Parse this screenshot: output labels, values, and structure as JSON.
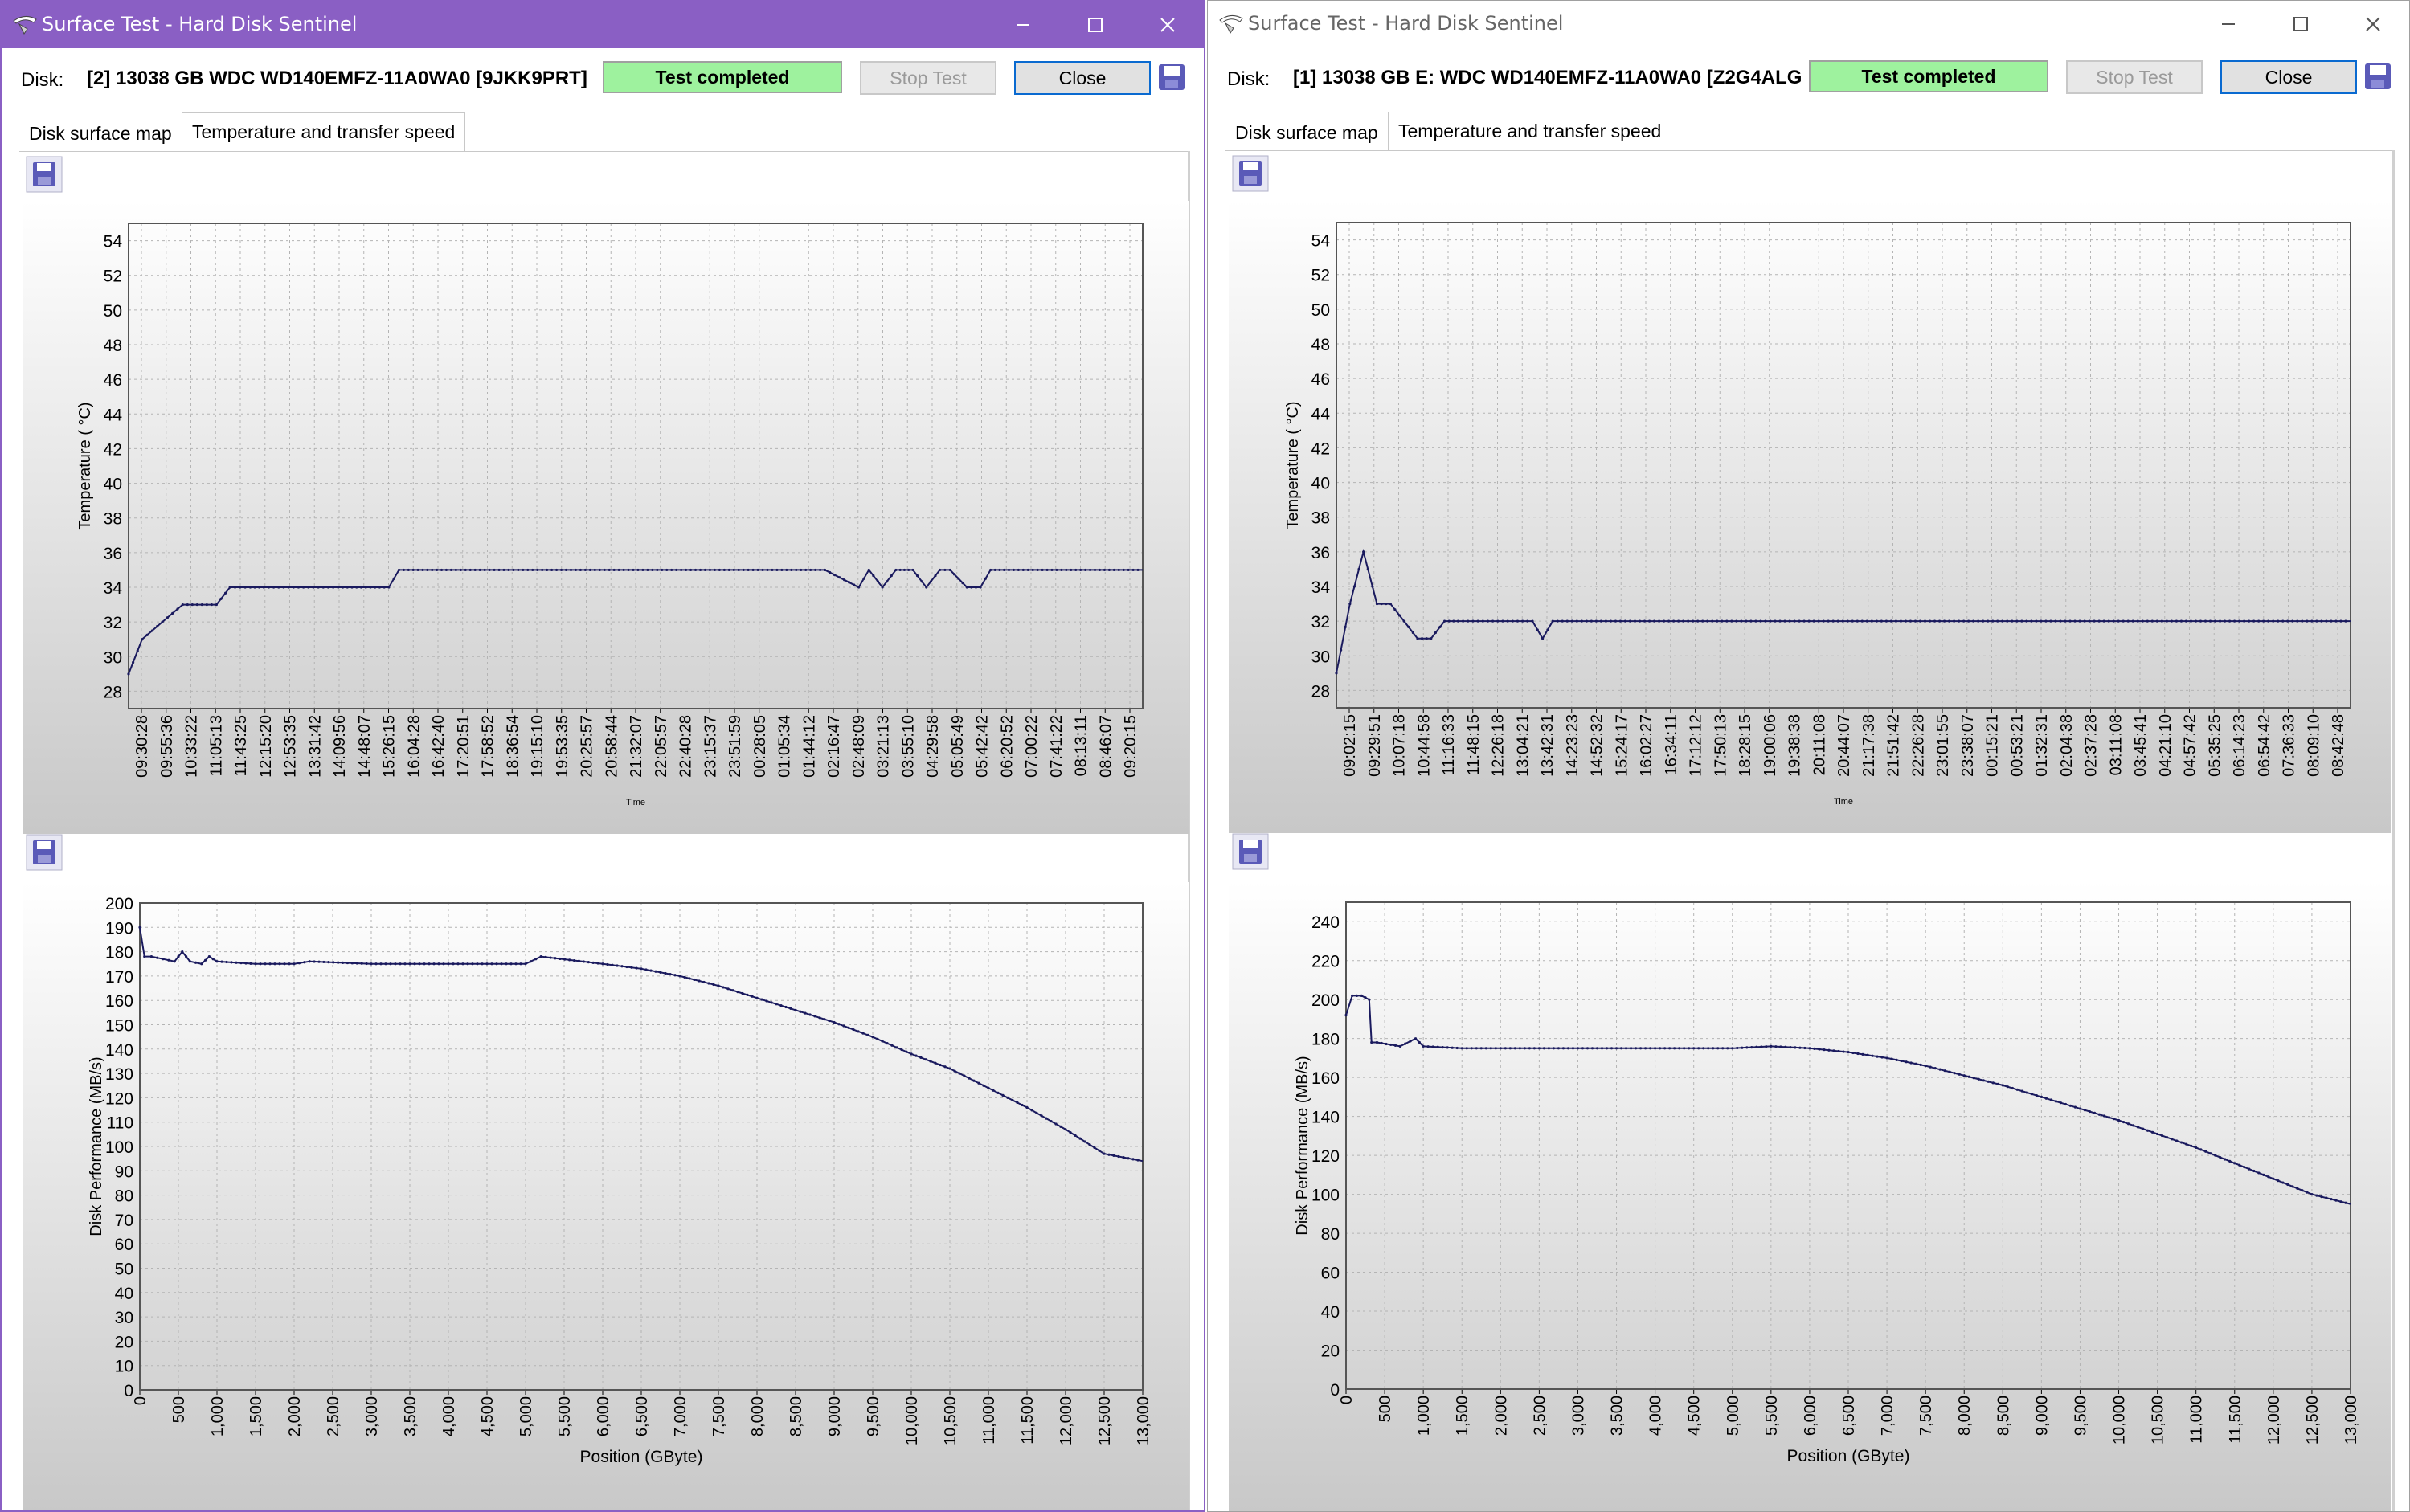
{
  "windows": [
    {
      "id": "left",
      "title": "Surface Test - Hard Disk Sentinel",
      "disk_label": "Disk:",
      "disk_name": "[2] 13038 GB  WDC WD140EMFZ-11A0WA0 [9JKK9PRT]",
      "status": "Test completed",
      "stop_button": "Stop Test",
      "close_button": "Close",
      "tabs": [
        "Disk surface map",
        "Temperature and transfer speed"
      ],
      "active_tab": "Temperature and transfer speed"
    },
    {
      "id": "right",
      "title": "Surface Test - Hard Disk Sentinel",
      "disk_label": "Disk:",
      "disk_name": "[1] 13038 GB E: WDC WD140EMFZ-11A0WA0 [Z2G4ALG",
      "status": "Test completed",
      "stop_button": "Stop Test",
      "close_button": "Close",
      "tabs": [
        "Disk surface map",
        "Temperature and transfer speed"
      ],
      "active_tab": "Temperature and transfer speed"
    }
  ],
  "colors": {
    "title_active": "#8a5fc4",
    "status_green": "#9ef29e",
    "line": "#1a1a5e",
    "plot_bg_top": "#ffffff",
    "plot_bg_bottom": "#c8c8c8"
  },
  "chart_data": [
    {
      "id": "left-temp",
      "type": "line",
      "ylabel": "Temperature ( °C)",
      "xlabel": "Time",
      "ylim": [
        27,
        55
      ],
      "yticks": [
        28,
        30,
        32,
        34,
        36,
        38,
        40,
        42,
        44,
        46,
        48,
        50,
        52,
        54
      ],
      "grid": true,
      "x_tick_labels": [
        "09:30:28",
        "09:55:36",
        "10:33:22",
        "11:05:13",
        "11:43:25",
        "12:15:20",
        "12:53:35",
        "13:31:42",
        "14:09:56",
        "14:48:07",
        "15:26:15",
        "16:04:28",
        "16:42:40",
        "17:20:51",
        "17:58:52",
        "18:36:54",
        "19:15:10",
        "19:53:35",
        "20:25:57",
        "20:58:44",
        "21:32:07",
        "22:05:57",
        "22:40:28",
        "23:15:37",
        "23:51:59",
        "00:28:05",
        "01:05:34",
        "01:44:12",
        "02:16:47",
        "02:48:09",
        "03:21:13",
        "03:55:10",
        "04:29:58",
        "05:05:49",
        "05:42:42",
        "06:20:52",
        "07:00:22",
        "07:41:22",
        "08:13:11",
        "08:46:07",
        "09:20:15"
      ],
      "series": [
        {
          "x": [
            0,
            0.4,
            1.0,
            1.6,
            2.6,
            3.0,
            3.6,
            4.0,
            6.2,
            7.7,
            8.0,
            9.4,
            20.6,
            21.6,
            21.9,
            22.3,
            22.7,
            23.2,
            23.6,
            24.0,
            24.3,
            24.8,
            25.2,
            25.5,
            25.9,
            30.0
          ],
          "values": [
            29,
            31,
            32,
            33,
            33,
            34,
            34,
            34,
            34,
            34,
            35,
            35,
            35,
            34,
            35,
            34,
            35,
            35,
            34,
            35,
            35,
            34,
            34,
            35,
            35,
            35
          ]
        }
      ],
      "x_range": [
        0,
        30
      ]
    },
    {
      "id": "left-perf",
      "type": "line",
      "ylabel": "Disk Performance (MB/s)",
      "xlabel": "Position (GByte)",
      "ylim": [
        0,
        200
      ],
      "yticks": [
        0,
        10,
        20,
        30,
        40,
        50,
        60,
        70,
        80,
        90,
        100,
        110,
        120,
        130,
        140,
        150,
        160,
        170,
        180,
        190,
        200
      ],
      "xlim": [
        0,
        13000
      ],
      "xticks": [
        0,
        500,
        1000,
        1500,
        2000,
        2500,
        3000,
        3500,
        4000,
        4500,
        5000,
        5500,
        6000,
        6500,
        7000,
        7500,
        8000,
        8500,
        9000,
        9500,
        10000,
        10500,
        11000,
        11500,
        12000,
        12500,
        13000
      ],
      "x_tick_labels": [
        "0",
        "500",
        "1,000",
        "1,500",
        "2,000",
        "2,500",
        "3,000",
        "3,500",
        "4,000",
        "4,500",
        "5,000",
        "5,500",
        "6,000",
        "6,500",
        "7,000",
        "7,500",
        "8,000",
        "8,500",
        "9,000",
        "9,500",
        "10,000",
        "10,500",
        "11,000",
        "11,500",
        "12,000",
        "12,500",
        "13,000"
      ],
      "grid": true,
      "series": [
        {
          "x": [
            0,
            60,
            150,
            300,
            450,
            550,
            650,
            800,
            900,
            1000,
            1500,
            2000,
            2200,
            3000,
            4000,
            5000,
            5200,
            6000,
            6500,
            7000,
            7500,
            8000,
            8500,
            9000,
            9500,
            10000,
            10500,
            11000,
            11500,
            12000,
            12500,
            13000
          ],
          "values": [
            190,
            178,
            178,
            177,
            176,
            180,
            176,
            175,
            178,
            176,
            175,
            175,
            176,
            175,
            175,
            175,
            178,
            175,
            173,
            170,
            166,
            161,
            156,
            151,
            145,
            138,
            132,
            124,
            116,
            107,
            97,
            94
          ]
        }
      ]
    },
    {
      "id": "right-temp",
      "type": "line",
      "ylabel": "Temperature ( °C)",
      "xlabel": "Time",
      "ylim": [
        27,
        55
      ],
      "yticks": [
        28,
        30,
        32,
        34,
        36,
        38,
        40,
        42,
        44,
        46,
        48,
        50,
        52,
        54
      ],
      "grid": true,
      "x_tick_labels": [
        "09:02:15",
        "09:29:51",
        "10:07:18",
        "10:44:58",
        "11:16:33",
        "11:48:15",
        "12:26:18",
        "13:04:21",
        "13:42:31",
        "14:23:23",
        "14:52:32",
        "15:24:17",
        "16:02:27",
        "16:34:11",
        "17:12:12",
        "17:50:13",
        "18:28:15",
        "19:00:06",
        "19:38:38",
        "20:11:08",
        "20:44:07",
        "21:17:38",
        "21:51:42",
        "22:26:28",
        "23:01:55",
        "23:38:07",
        "00:15:21",
        "00:53:21",
        "01:32:31",
        "02:04:38",
        "02:37:28",
        "03:11:08",
        "03:45:41",
        "04:21:10",
        "04:57:42",
        "05:35:25",
        "06:14:23",
        "06:54:42",
        "07:36:33",
        "08:09:10",
        "08:42:48"
      ],
      "series": [
        {
          "x": [
            0,
            0.4,
            0.8,
            1.2,
            1.6,
            2.0,
            2.4,
            2.8,
            3.2,
            3.6,
            5.8,
            6.1,
            6.4,
            30.0
          ],
          "values": [
            29,
            33,
            36,
            33,
            33,
            32,
            31,
            31,
            32,
            32,
            32,
            31,
            32,
            32
          ]
        }
      ],
      "x_range": [
        0,
        30
      ]
    },
    {
      "id": "right-perf",
      "type": "line",
      "ylabel": "Disk Performance (MB/s)",
      "xlabel": "Position (GByte)",
      "ylim": [
        0,
        250
      ],
      "yticks": [
        0,
        20,
        40,
        60,
        80,
        100,
        120,
        140,
        160,
        180,
        200,
        220,
        240
      ],
      "xlim": [
        0,
        13000
      ],
      "xticks": [
        0,
        500,
        1000,
        1500,
        2000,
        2500,
        3000,
        3500,
        4000,
        4500,
        5000,
        5500,
        6000,
        6500,
        7000,
        7500,
        8000,
        8500,
        9000,
        9500,
        10000,
        10500,
        11000,
        11500,
        12000,
        12500,
        13000
      ],
      "x_tick_labels": [
        "0",
        "500",
        "1,000",
        "1,500",
        "2,000",
        "2,500",
        "3,000",
        "3,500",
        "4,000",
        "4,500",
        "5,000",
        "5,500",
        "6,000",
        "6,500",
        "7,000",
        "7,500",
        "8,000",
        "8,500",
        "9,000",
        "9,500",
        "10,000",
        "10,500",
        "11,000",
        "11,500",
        "12,000",
        "12,500",
        "13,000"
      ],
      "grid": true,
      "series": [
        {
          "x": [
            0,
            80,
            200,
            300,
            330,
            400,
            700,
            900,
            1000,
            1500,
            2000,
            2500,
            3000,
            4000,
            5000,
            5500,
            6000,
            6500,
            7000,
            7500,
            8000,
            8500,
            9000,
            9500,
            10000,
            10500,
            11000,
            11500,
            12000,
            12500,
            13000
          ],
          "values": [
            192,
            202,
            202,
            200,
            178,
            178,
            176,
            180,
            176,
            175,
            175,
            175,
            175,
            175,
            175,
            176,
            175,
            173,
            170,
            166,
            161,
            156,
            150,
            144,
            138,
            131,
            124,
            116,
            108,
            100,
            95
          ]
        }
      ]
    }
  ]
}
